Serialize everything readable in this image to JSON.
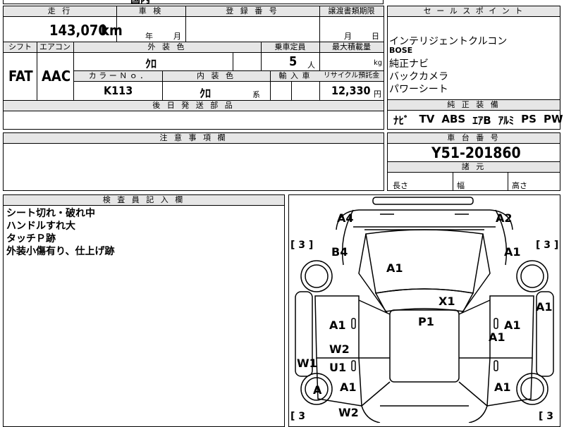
{
  "top_partial": "国内",
  "mileage": {
    "label": "走 行",
    "value": "143,070",
    "unit": "km"
  },
  "inspection": {
    "label": "車 検",
    "year": "年",
    "month": "月"
  },
  "registration": {
    "label": "登 録 番 号"
  },
  "transfer": {
    "label": "譲渡書類期限",
    "month": "月",
    "day": "日"
  },
  "shift": {
    "label": "シフト",
    "value": "FAT"
  },
  "aircon": {
    "label": "エアコン",
    "value": "AAC"
  },
  "exterior": {
    "label": "外 装 色",
    "value": "ｸﾛ"
  },
  "capacity": {
    "label": "乗車定員",
    "value": "5",
    "unit": "人"
  },
  "max_load": {
    "label": "最大積載量",
    "unit": "kg"
  },
  "color_no": {
    "label": "カ ラ ー Ｎ ｏ ．",
    "value": "K113"
  },
  "interior": {
    "label": "内 装 色",
    "value": "ｸﾛ",
    "suffix": "系"
  },
  "import": {
    "label": "輸 入 車"
  },
  "recycle": {
    "label": "リサイクル預託金",
    "value": "12,330",
    "unit": "円"
  },
  "later_parts": {
    "label": "後 日 発 送 部 品"
  },
  "sales_points": {
    "label": "セ ー ル ス ポ イ ン ト",
    "items": [
      "インテリジェントクルコン",
      "BOSE",
      "純正ナビ",
      "バックカメラ",
      "パワーシート"
    ]
  },
  "equipment": {
    "label": "純 正 装 備",
    "items": [
      "ﾅﾋﾞ",
      "TV",
      "ABS",
      "ｴｱB",
      "ｱﾙﾐ",
      "PS",
      "PW"
    ]
  },
  "notes": {
    "label": "注 意 事 項 欄"
  },
  "chassis": {
    "label": "車 台 番 号",
    "value": "Y51-201860"
  },
  "dims": {
    "label": "諸 元",
    "length": "長さ",
    "width": "幅",
    "height": "高さ"
  },
  "inspector": {
    "label": "検 査 員 記 入 欄",
    "lines": [
      "シート切れ・破れ中",
      "ハンドルすれ大",
      "タッチＰ跡",
      "外装小傷有り、仕上げ跡"
    ]
  },
  "tire_marks": [
    "[ 3 ]",
    "[ 3 ]",
    "[ 3",
    "[ 3"
  ],
  "damage": {
    "front_left": "A4",
    "front_right": "A2",
    "fender_left": "B4",
    "fender_right": "A1",
    "hood": "A1",
    "windshield": "X1",
    "roof": "P1",
    "door_fl": "A1",
    "door_fr": "A1",
    "door_fr2": "A1",
    "side_right": "A1",
    "mirror_l": "W2",
    "pillar_l": "U1",
    "sill_l": "W1",
    "door_rl": "A1",
    "door_rr": "A1",
    "tire_rl": "A",
    "rear_l": "W2"
  }
}
